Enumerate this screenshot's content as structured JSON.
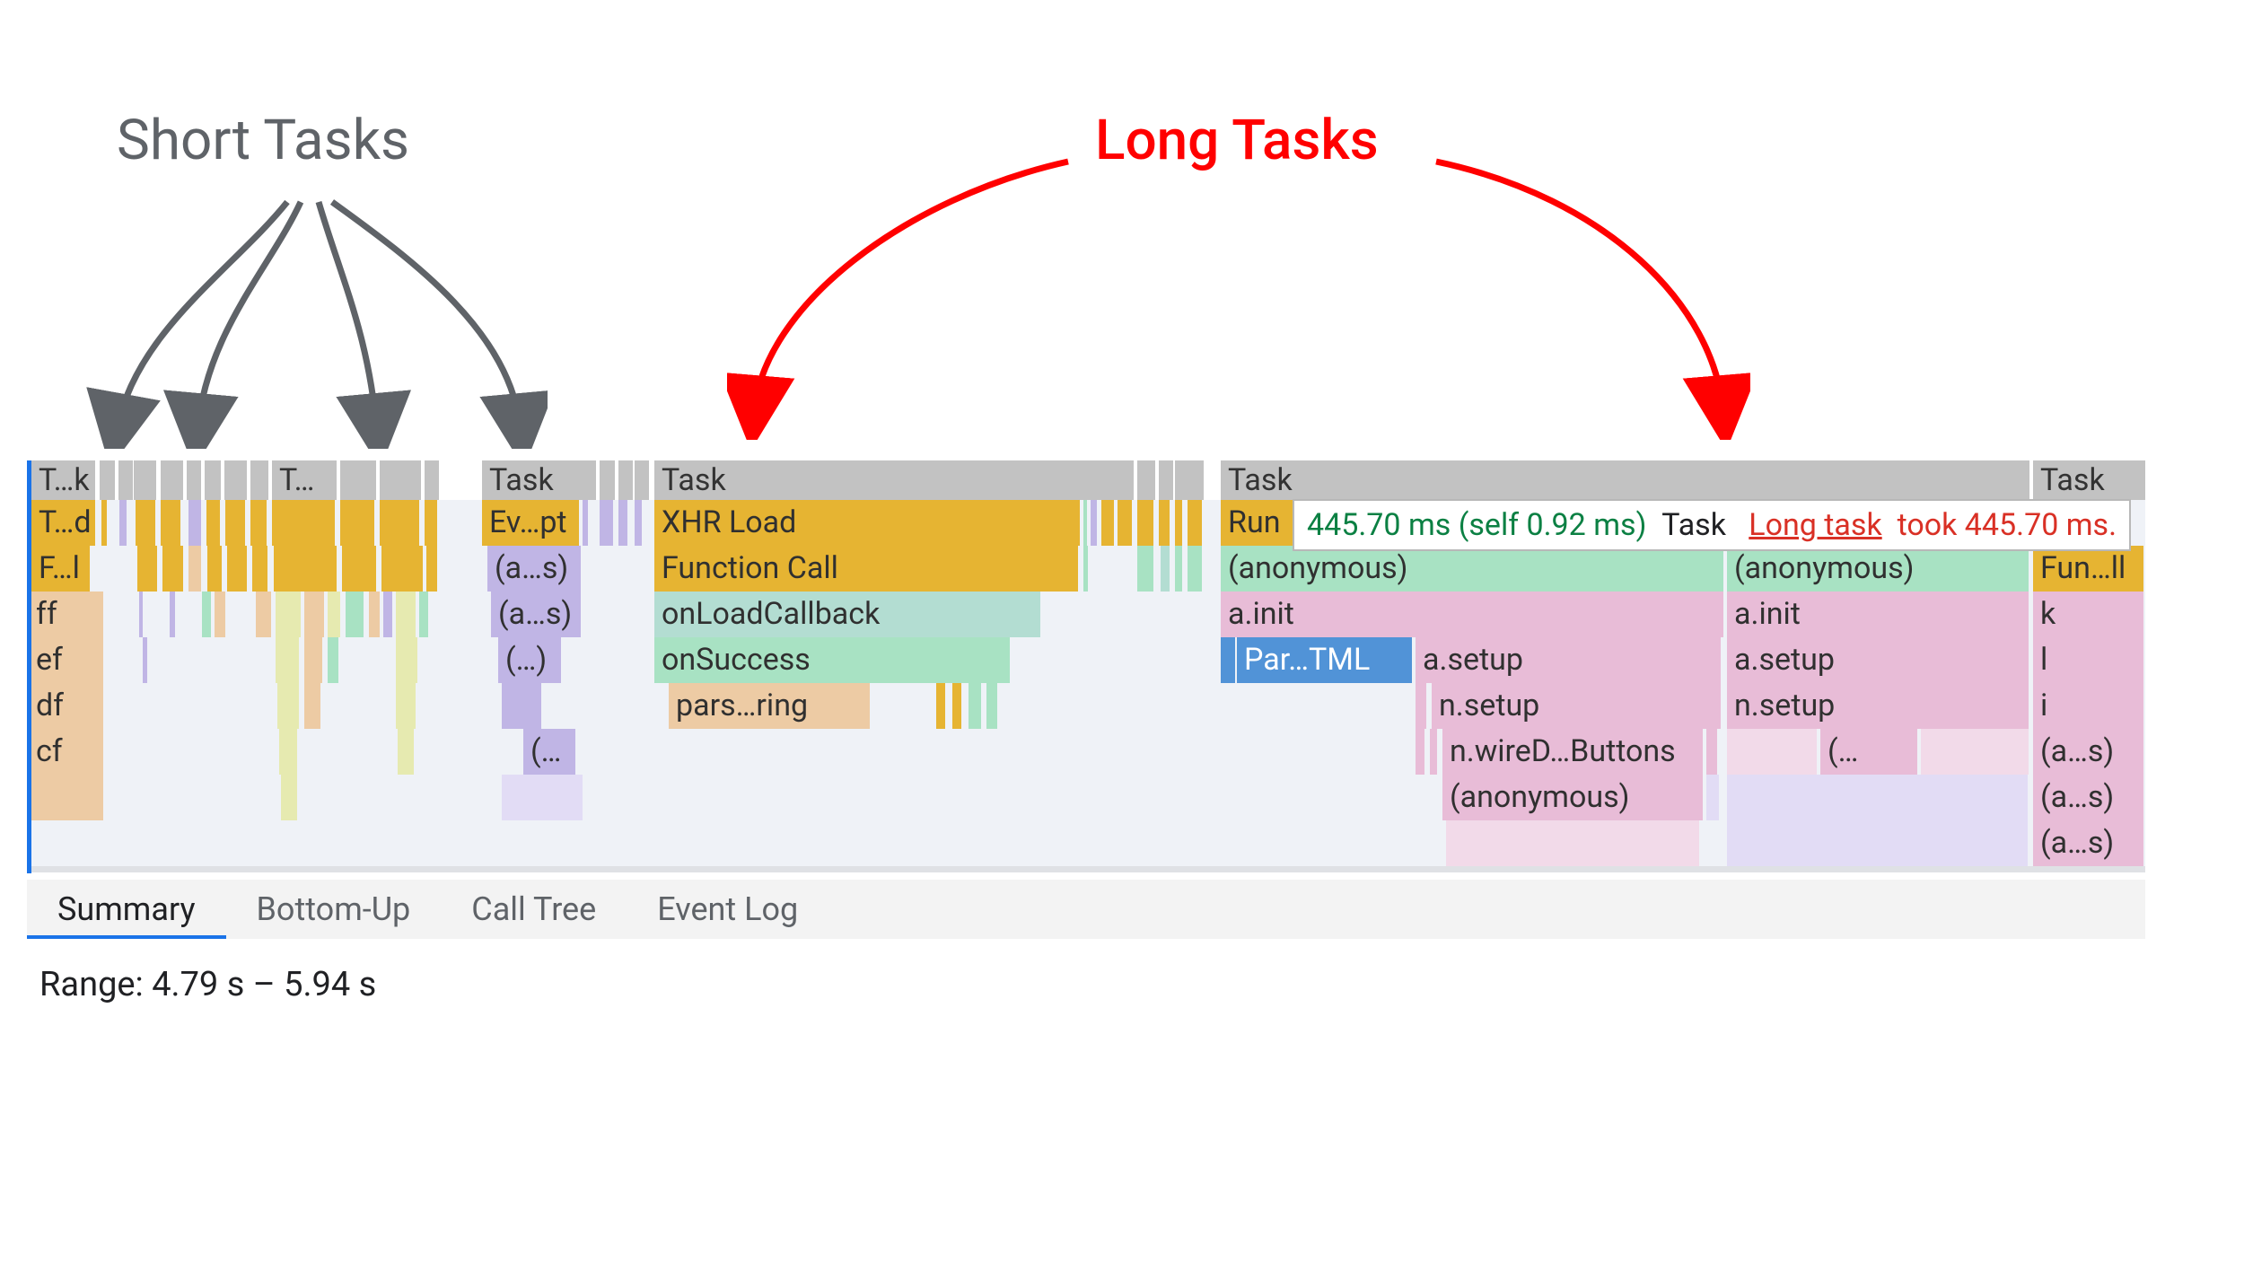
{
  "annotations": {
    "short_tasks": "Short Tasks",
    "long_tasks": "Long Tasks"
  },
  "tooltip": {
    "timing": "445.70 ms (self 0.92 ms)",
    "kind": "Task",
    "link_text": "Long task",
    "tail": "took 445.70 ms."
  },
  "tabs": {
    "summary": "Summary",
    "bottom_up": "Bottom-Up",
    "call_tree": "Call Tree",
    "event_log": "Event Log"
  },
  "range_label": "Range:",
  "range_value": "4.79 s – 5.94 s",
  "flame": {
    "row0_tk": "T…k",
    "row0_t": "T…",
    "row0_task_a": "Task",
    "row0_task_b": "Task",
    "row0_task_c": "Task",
    "row0_task_d": "Task",
    "row1_td": "T…d",
    "row1_evpt": "Ev…pt",
    "row1_xhr": "XHR Load",
    "row1_run": "Run",
    "row2_fl": "F…l",
    "row2_as": "(a…s)",
    "row2_fc": "Function Call",
    "row2_anon1": "(anonymous)",
    "row2_anon2": "(anonymous)",
    "row2_funll": "Fun…ll",
    "row3_ff": "ff",
    "row3_as": "(a…s)",
    "row3_olc": "onLoadCallback",
    "row3_ainit1": "a.init",
    "row3_ainit2": "a.init",
    "row3_k": "k",
    "row4_ef": "ef",
    "row4_paren": "(…)",
    "row4_succ": "onSuccess",
    "row4_partml": "Par…TML",
    "row4_asetup1": "a.setup",
    "row4_asetup2": "a.setup",
    "row4_l": "l",
    "row5_df": "df",
    "row5_pars": "pars…ring",
    "row5_nsetup1": "n.setup",
    "row5_nsetup2": "n.setup",
    "row5_i": "i",
    "row6_cf": "cf",
    "row6_paren": "(…",
    "row6_wire": "n.wireD…Buttons",
    "row6_paren2": "(…",
    "row6_as": "(a…s)",
    "row7_anon": "(anonymous)",
    "row7_as": "(a…s)",
    "row8_as": "(a…s)"
  }
}
